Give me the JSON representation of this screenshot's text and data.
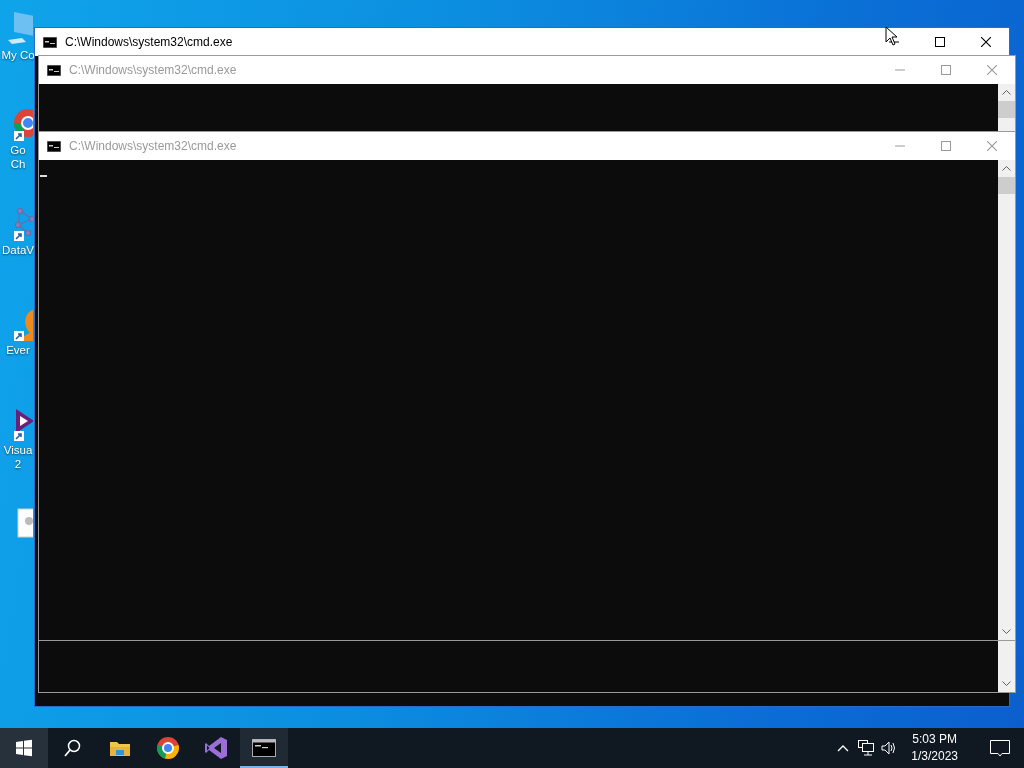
{
  "desktop_icons": [
    {
      "kind": "computer",
      "label_lines": [
        "My Co"
      ]
    },
    {
      "kind": "chrome",
      "label_lines": [
        "Go",
        "Ch"
      ]
    },
    {
      "kind": "graph",
      "label_lines": [
        "DataV"
      ]
    },
    {
      "kind": "orange",
      "label_lines": [
        "Ever"
      ]
    },
    {
      "kind": "studio",
      "label_lines": [
        "Visua",
        "2"
      ]
    },
    {
      "kind": "document"
    }
  ],
  "windows": [
    {
      "title": "C:\\Windows\\system32\\cmd.exe",
      "active": true,
      "text_cursor": false
    },
    {
      "title": "C:\\Windows\\system32\\cmd.exe",
      "active": false,
      "text_cursor": false
    },
    {
      "title": "C:\\Windows\\system32\\cmd.exe",
      "active": false,
      "text_cursor": true
    }
  ],
  "taskbar": {
    "apps": [
      {
        "kind": "start",
        "running": false
      },
      {
        "kind": "search",
        "running": false
      },
      {
        "kind": "explorer",
        "running": false
      },
      {
        "kind": "chrome",
        "running": false
      },
      {
        "kind": "studio",
        "running": false
      },
      {
        "kind": "console",
        "running": true
      }
    ],
    "time": "5:03 PM",
    "date": "1/3/2023"
  }
}
